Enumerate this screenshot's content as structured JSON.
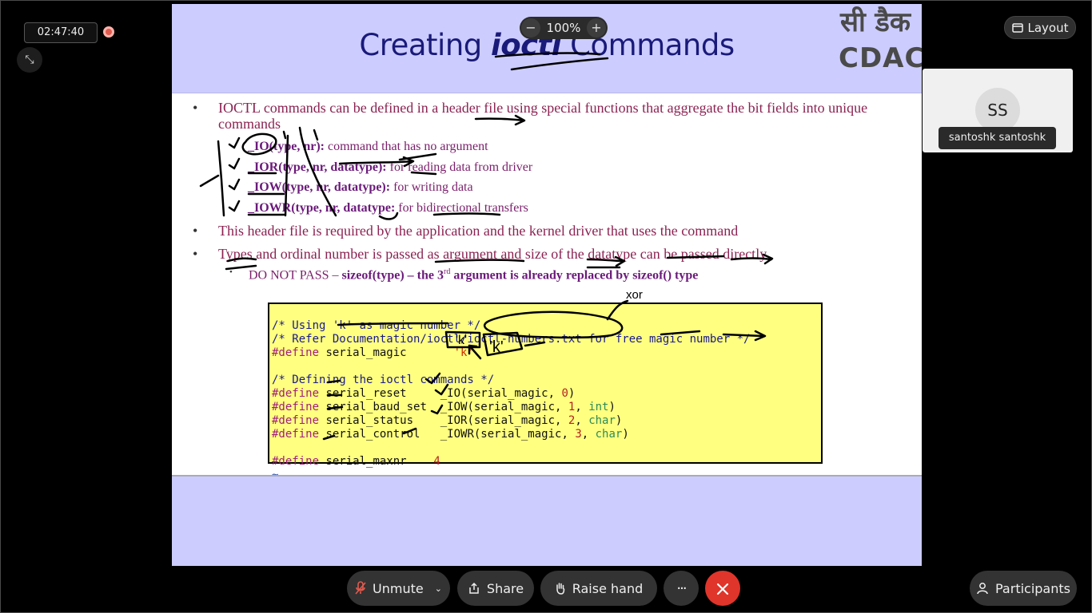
{
  "timer": "02:47:40",
  "zoom": {
    "value": "100%",
    "minus": "−",
    "plus": "+"
  },
  "layout_label": "Layout",
  "participant": {
    "initials": "SS",
    "name": "santoshk santoshk"
  },
  "slide": {
    "title_pre": "Creating ",
    "title_em": "ioctl",
    "title_post": " Commands",
    "logo_hindi": "सी डैक",
    "logo_latin": "CDAC",
    "bullets": [
      "IOCTL commands can be defined in a header file using special functions that aggregate the bit fields into unique commands",
      "This header file is required by the application and the kernel driver that uses the command",
      "Types and ordinal number is passed as argument and size of the datatype can be passed directly"
    ],
    "subbullets": [
      {
        "sig": "_IO(type, nr):",
        "desc": " command that has no argument"
      },
      {
        "sig": "_IOR(type, nr, datatype):",
        "desc": " for reading data from driver"
      },
      {
        "sig": "_IOW(type, nr, datatype):",
        "desc": " for writing data"
      },
      {
        "sig": "_IOWR(type, nr, datatype:",
        "desc": " for bidirectional transfers"
      }
    ],
    "dnp_plain": "DO NOT PASS – ",
    "dnp_bold1": "sizeof(type) – the 3",
    "dnp_sup": "rd",
    "dnp_bold2": " argument is already replaced by sizeof() type",
    "code": {
      "l1": "/* Using 'k' as magic number */",
      "l2": "/* Refer Documentation/ioctl/ioctl-numbers.txt for free magic number */",
      "l3_kw": "#define",
      "l3_id": " serial_magic       ",
      "l3_str": "'k'",
      "l5": "/* Defining the ioctl commands */",
      "l6_kw": "#define",
      "l6_id": " serial_reset     _IO(serial_magic, ",
      "l6_num": "0",
      "l6_end": ")",
      "l7_kw": "#define",
      "l7_id": " serial_baud_set  _IOW(serial_magic, ",
      "l7_num": "1",
      "l7_sep": ", ",
      "l7_type": "int",
      "l7_end": ")",
      "l8_kw": "#define",
      "l8_id": " serial_status    _IOR(serial_magic, ",
      "l8_num": "2",
      "l8_sep": ", ",
      "l8_type": "char",
      "l8_end": ")",
      "l9_kw": "#define",
      "l9_id": " serial_control   _IOWR(serial_magic, ",
      "l9_num": "3",
      "l9_sep": ", ",
      "l9_type": "char",
      "l9_end": ")",
      "l11_kw": "#define",
      "l11_id": " serial_maxnr    ",
      "l11_num": "4",
      "l12": "~"
    },
    "annotation_k": "'k'",
    "annotation_xor": "xor"
  },
  "bottom_bar": {
    "unmute": "Unmute",
    "share": "Share",
    "raise_hand": "Raise hand",
    "more": "···",
    "participants": "Participants"
  },
  "colors": {
    "slide_band": "#ccccff",
    "title": "#1a1a7a",
    "bullet": "#8b2252",
    "code_bg": "#ffff80",
    "end_call": "#e0352b",
    "rec": "#e05a4e"
  }
}
